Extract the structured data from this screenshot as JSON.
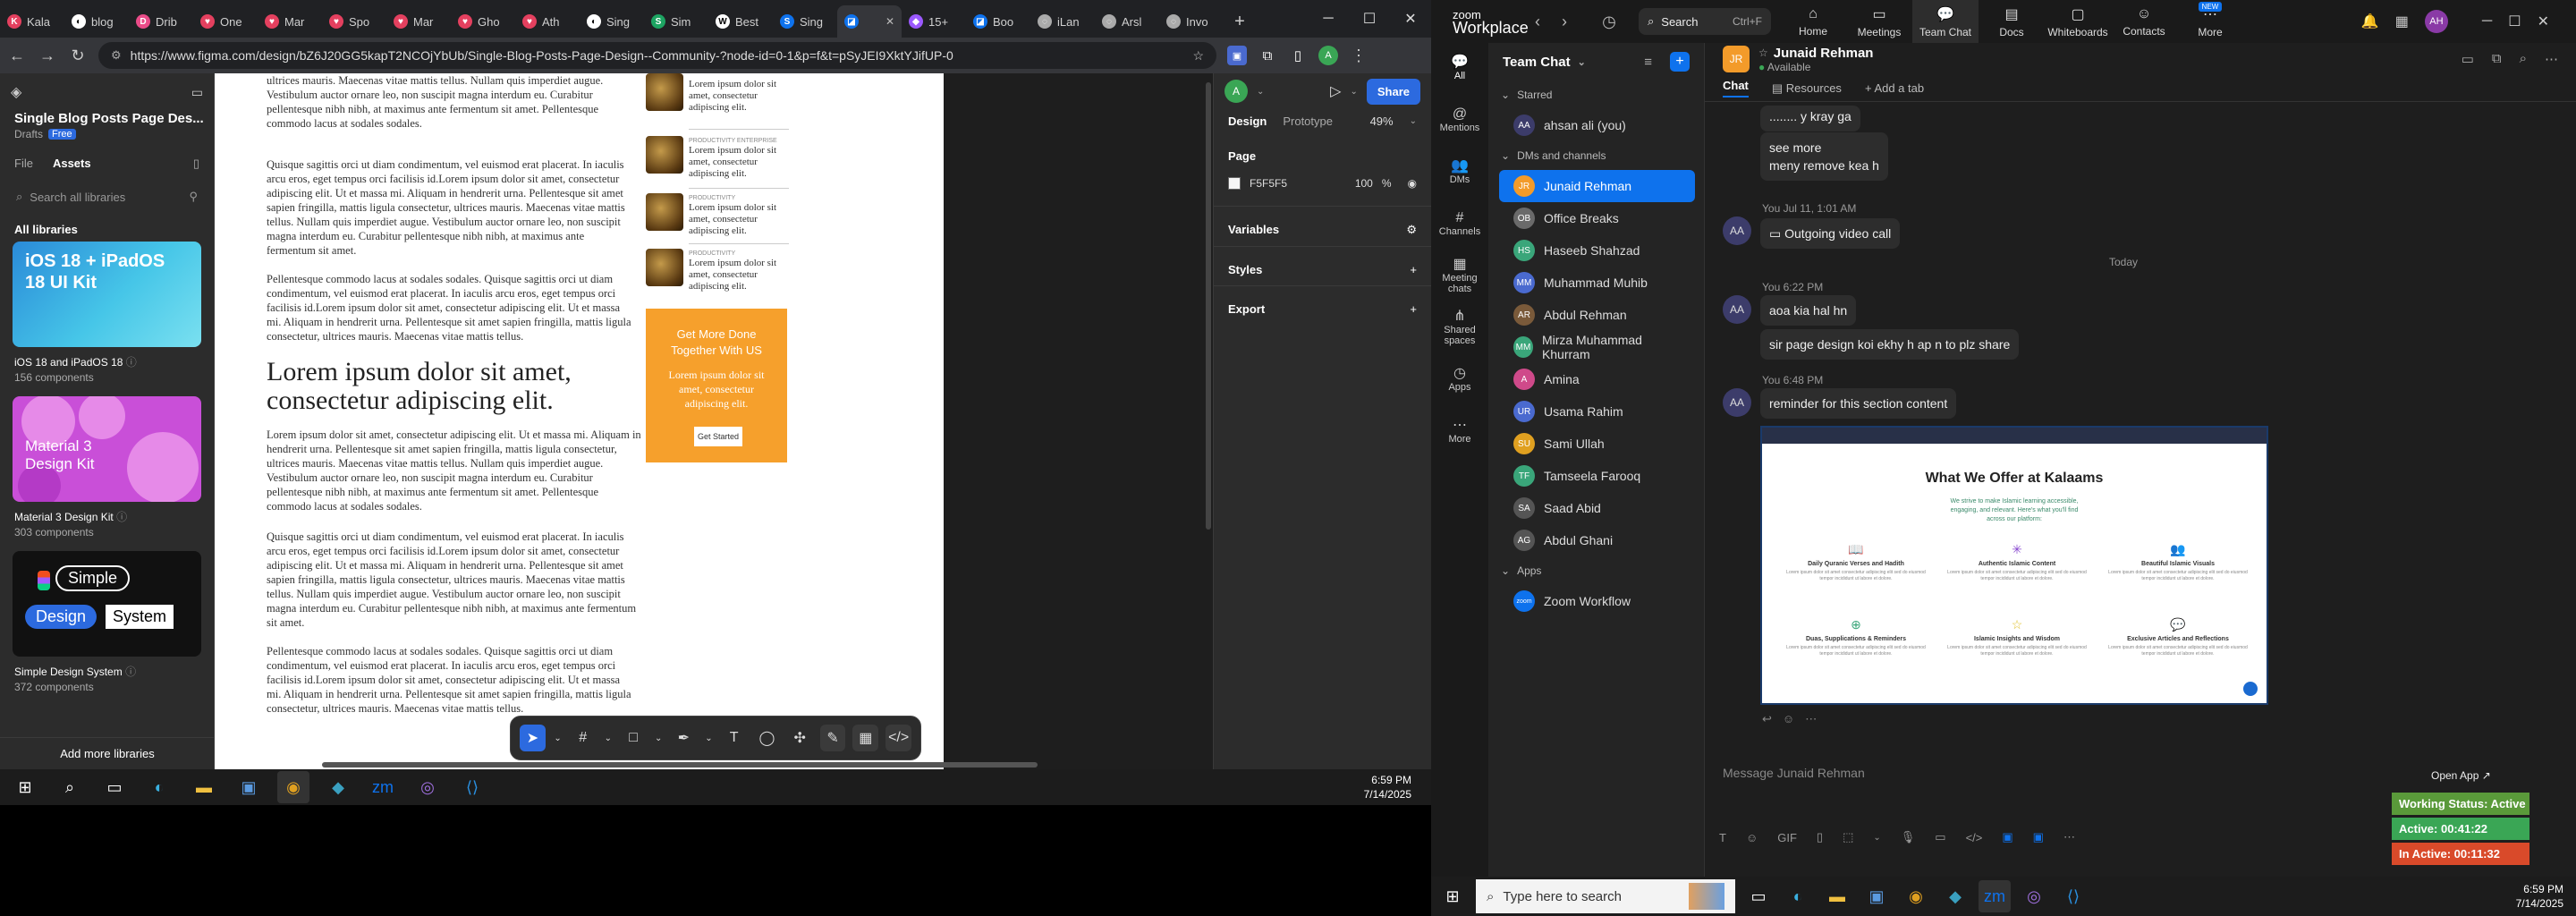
{
  "browser": {
    "tabs": [
      {
        "label": "Kala",
        "color": "#e4405f",
        "glyph": "K"
      },
      {
        "label": "blog",
        "color": "#ffffff",
        "glyph": "◐"
      },
      {
        "label": "Drib",
        "color": "#ea4c89",
        "glyph": "D"
      },
      {
        "label": "One",
        "color": "#e4405f",
        "glyph": "♥"
      },
      {
        "label": "Mar",
        "color": "#e4405f",
        "glyph": "♥"
      },
      {
        "label": "Spo",
        "color": "#e4405f",
        "glyph": "♥"
      },
      {
        "label": "Mar",
        "color": "#e4405f",
        "glyph": "♥"
      },
      {
        "label": "Gho",
        "color": "#e4405f",
        "glyph": "♥"
      },
      {
        "label": "Ath",
        "color": "#e4405f",
        "glyph": "♥"
      },
      {
        "label": "Sing",
        "color": "#ffffff",
        "glyph": "◐"
      },
      {
        "label": "Sim",
        "color": "#1da462",
        "glyph": "S"
      },
      {
        "label": "Best",
        "color": "#ffffff",
        "glyph": "W"
      },
      {
        "label": "Sing",
        "color": "#0e72ed",
        "glyph": "S"
      },
      {
        "label": "",
        "color": "#0e72ed",
        "glyph": "◪"
      },
      {
        "label": "15+",
        "color": "#9b59ff",
        "glyph": "◆"
      },
      {
        "label": "Boo",
        "color": "#0e72ed",
        "glyph": "◪"
      },
      {
        "label": "iLan",
        "color": "#aaaaaa",
        "glyph": "◌"
      },
      {
        "label": "Arsl",
        "color": "#aaaaaa",
        "glyph": "◌"
      },
      {
        "label": "Invo",
        "color": "#aaaaaa",
        "glyph": "◌"
      }
    ],
    "url": "https://www.figma.com/design/bZ6J20GG5kapT2NCOjYbUb/Single-Blog-Posts-Page-Design--Community-?node-id=0-1&p=f&t=pSyJEI9XktYJifUP-0"
  },
  "figma": {
    "file_title": "Single Blog Posts Page Des...",
    "drafts": "Drafts",
    "plan_badge": "Free",
    "tab_file": "File",
    "tab_assets": "Assets",
    "search_placeholder": "Search all libraries",
    "all_libraries": "All libraries",
    "libraries": [
      {
        "name": "iOS 18 and iPadOS 18",
        "count": "156 components",
        "cover": "iOS 18 + iPadOS 18 UI Kit"
      },
      {
        "name": "Material 3 Design Kit",
        "count": "303 components",
        "cover": "Material 3 Design Kit"
      },
      {
        "name": "Simple Design System",
        "count": "372 components",
        "cover_words": [
          "Simple",
          "Design",
          "System"
        ]
      }
    ],
    "add_more": "Add more libraries",
    "canvas": {
      "para1": "ultrices mauris. Maecenas vitae mattis tellus. Nullam quis imperdiet augue. Vestibulum auctor ornare leo, non suscipit magna interdum eu. Curabitur pellentesque nibh nibh, at maximus ante fermentum sit amet. Pellentesque commodo lacus at sodales sodales.",
      "para2": "Quisque sagittis orci ut diam condimentum, vel euismod erat placerat. In iaculis arcu eros, eget tempus orci facilisis id.Lorem ipsum dolor sit amet, consectetur adipiscing elit. Ut et massa mi. Aliquam in hendrerit urna. Pellentesque sit amet sapien fringilla, mattis ligula consectetur, ultrices mauris. Maecenas vitae mattis tellus. Nullam quis imperdiet augue. Vestibulum auctor ornare leo, non suscipit magna interdum eu. Curabitur pellentesque nibh nibh, at maximus ante fermentum sit amet.",
      "para3": "Pellentesque commodo lacus at sodales sodales. Quisque sagittis orci ut diam condimentum, vel euismod erat placerat. In iaculis arcu eros, eget tempus orci facilisis id.Lorem ipsum dolor sit amet, consectetur adipiscing elit. Ut et massa mi. Aliquam in hendrerit urna. Pellentesque sit amet sapien fringilla, mattis ligula consectetur, ultrices mauris. Maecenas vitae mattis tellus.",
      "heading": "Lorem ipsum dolor sit amet, consectetur adipiscing elit.",
      "para4": "Lorem ipsum dolor sit amet, consectetur adipiscing elit. Ut et massa mi. Aliquam in hendrerit urna. Pellentesque sit amet sapien fringilla, mattis ligula consectetur, ultrices mauris. Maecenas vitae mattis tellus. Nullam quis imperdiet augue. Vestibulum auctor ornare leo, non suscipit magna interdum eu. Curabitur pellentesque nibh nibh, at maximus ante fermentum sit amet. Pellentesque commodo lacus at sodales sodales.",
      "para5": "Quisque sagittis orci ut diam condimentum, vel euismod erat placerat. In iaculis arcu eros, eget tempus orci facilisis id.Lorem ipsum dolor sit amet, consectetur adipiscing elit. Ut et massa mi. Aliquam in hendrerit urna. Pellentesque sit amet sapien fringilla, mattis ligula consectetur, ultrices mauris. Maecenas vitae mattis tellus. Nullam quis imperdiet augue. Vestibulum auctor ornare leo, non suscipit magna interdum eu. Curabitur pellentesque nibh nibh, at maximus ante fermentum sit amet.",
      "para6": "Pellentesque commodo lacus at sodales sodales. Quisque sagittis orci ut diam condimentum, vel euismod erat placerat. In iaculis arcu eros, eget tempus orci facilisis id.Lorem ipsum dolor sit amet, consectetur adipiscing elit. Ut et massa mi. Aliquam in hendrerit urna. Pellentesque sit amet sapien fringilla, mattis ligula consectetur, ultrices mauris. Maecenas vitae mattis tellus.",
      "side_posts": [
        {
          "category": "",
          "title": "Lorem ipsum dolor sit amet, consectetur adipiscing elit."
        },
        {
          "category": "PRODUCTIVITY ENTERPRISE",
          "title": "Lorem ipsum dolor sit amet, consectetur adipiscing elit."
        },
        {
          "category": "PRODUCTIVITY",
          "title": "Lorem ipsum dolor sit amet, consectetur adipiscing elit."
        },
        {
          "category": "PRODUCTIVITY",
          "title": "Lorem ipsum dolor sit amet, consectetur adipiscing elit."
        }
      ],
      "cta_heading": "Get More Done Together With US",
      "cta_text": "Lorem ipsum dolor sit amet, consectetur adipiscing elit.",
      "cta_button": "Get Started"
    },
    "right": {
      "tab_design": "Design",
      "tab_prototype": "Prototype",
      "zoom": "49%",
      "share": "Share",
      "avatar_initial": "A",
      "section_page": "Page",
      "page_color": "F5F5F5",
      "page_opacity": "100",
      "percent": "%",
      "variables": "Variables",
      "styles": "Styles",
      "export": "Export"
    },
    "help": "?"
  },
  "taskbar_left": {
    "time": "6:59 PM",
    "date": "7/14/2025"
  },
  "zoom": {
    "logo_line1": "zoom",
    "logo_line2": "Workplace",
    "search": "Search",
    "search_shortcut": "Ctrl+F",
    "top_tabs": [
      {
        "label": "Home",
        "icon": "⌂"
      },
      {
        "label": "Meetings",
        "icon": "▭"
      },
      {
        "label": "Team Chat",
        "icon": "💬"
      },
      {
        "label": "Docs",
        "icon": "▤"
      },
      {
        "label": "Whiteboards",
        "icon": "▢"
      },
      {
        "label": "Contacts",
        "icon": "☺"
      },
      {
        "label": "More",
        "icon": "⋯"
      }
    ],
    "new_badge": "NEW",
    "user_initials": "AH",
    "rail": [
      {
        "label": "All",
        "icon": "💬"
      },
      {
        "label": "Mentions",
        "icon": "@"
      },
      {
        "label": "DMs",
        "icon": "👥"
      },
      {
        "label": "Channels",
        "icon": "#"
      },
      {
        "label": "Meeting chats",
        "icon": "▦"
      },
      {
        "label": "Shared spaces",
        "icon": "⋔"
      },
      {
        "label": "Apps",
        "icon": "◷"
      },
      {
        "label": "More",
        "icon": "⋯"
      }
    ],
    "list_title": "Team Chat",
    "starred": "Starred",
    "self": {
      "name": "ahsan ali (you)",
      "initials": "AA"
    },
    "dms_header": "DMs and channels",
    "contacts": [
      {
        "name": "Junaid Rehman",
        "initials": "JR",
        "color": "#f39b2a",
        "active": true
      },
      {
        "name": "Office Breaks",
        "initials": "OB",
        "color": "#6a6a6a",
        "active": false
      },
      {
        "name": "Haseeb Shahzad",
        "initials": "HS",
        "color": "#3aa67a",
        "active": false
      },
      {
        "name": "Muhammad Muhib",
        "initials": "MM",
        "color": "#4a6acf",
        "active": false
      },
      {
        "name": "Abdul Rehman",
        "initials": "AR",
        "color": "#7a5a3a",
        "active": false
      },
      {
        "name": "Mirza Muhammad Khurram",
        "initials": "MM",
        "color": "#3aa67a",
        "active": false
      },
      {
        "name": "Amina",
        "initials": "A",
        "color": "#cf4a8a",
        "active": false
      },
      {
        "name": "Usama Rahim",
        "initials": "UR",
        "color": "#4a6acf",
        "active": false
      },
      {
        "name": "Sami Ullah",
        "initials": "SU",
        "color": "#e0a020",
        "active": false
      },
      {
        "name": "Tamseela Farooq",
        "initials": "TF",
        "color": "#3aa67a",
        "active": false
      },
      {
        "name": "Saad Abid",
        "initials": "SA",
        "color": "#555555",
        "active": false
      },
      {
        "name": "Abdul Ghani",
        "initials": "AG",
        "color": "#555555",
        "active": false
      }
    ],
    "apps_header": "Apps",
    "apps": [
      {
        "name": "Zoom Workflow",
        "initials": "zoom",
        "color": "#0e72ed"
      }
    ],
    "chat_name": "Junaid Rehman",
    "chat_status": "Available",
    "chat_initials": "JR",
    "chat_tabs": [
      "Chat",
      "Resources",
      "Add a tab"
    ],
    "messages": {
      "m1": "........ y kray ga",
      "m2": "see more\nmeny remove kea h",
      "meta_call": "You  Jul 11, 1:01 AM",
      "call": "Outgoing video call",
      "today": "Today",
      "meta_622": "You  6:22 PM",
      "m3": "aoa kia hal hn",
      "m4": "sir page design koi ekhy h ap n to plz share",
      "meta_648": "You  6:48 PM",
      "m5": "reminder for this section content",
      "sender_initials": "AA"
    },
    "shot": {
      "title": "What We Offer at Kalaams",
      "lead": "We strive to make Islamic learning accessible, engaging, and relevant. Here's what you'll find across our platform:",
      "features": [
        {
          "title": "Daily Quranic Verses and Hadith",
          "icon": "📖",
          "color": "#e08a2a"
        },
        {
          "title": "Authentic Islamic Content",
          "icon": "✳",
          "color": "#8a4ad0"
        },
        {
          "title": "Beautiful Islamic Visuals",
          "icon": "👥",
          "color": "#3aa67a"
        },
        {
          "title": "Duas, Supplications & Reminders",
          "icon": "⊕",
          "color": "#3aa67a"
        },
        {
          "title": "Islamic Insights and Wisdom",
          "icon": "☆",
          "color": "#e0c02a"
        },
        {
          "title": "Exclusive Articles and Reflections",
          "icon": "💬",
          "color": "#cf4a8a"
        }
      ],
      "feature_desc": "Lorem ipsum dolor sit amet consectetur adipiscing elit sed do eiusmod tempor incididunt ut labore et dolore."
    },
    "compose_placeholder": "Message Junaid Rehman",
    "open_app": "Open App",
    "status_working": "Working Status: Active",
    "status_active": "Active: 00:41:22",
    "status_inactive": "In Active: 00:11:32"
  },
  "taskbar_right": {
    "search": "Type here to search",
    "time": "6:59 PM",
    "date": "7/14/2025"
  }
}
